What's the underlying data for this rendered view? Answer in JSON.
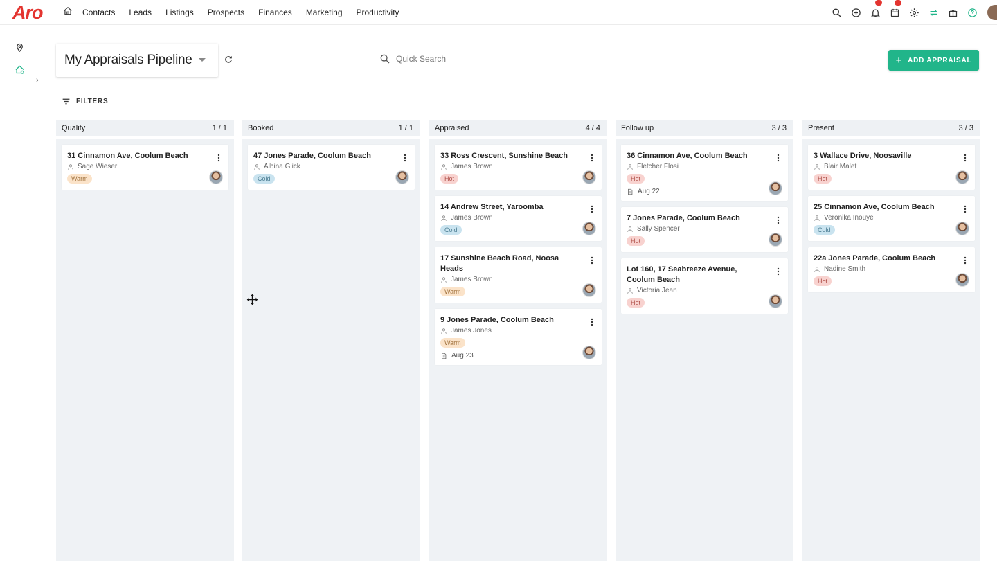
{
  "app": {
    "logo": "Aro"
  },
  "nav": [
    "Contacts",
    "Leads",
    "Listings",
    "Prospects",
    "Finances",
    "Marketing",
    "Productivity"
  ],
  "header": {
    "pipeline_title": "My Appraisals Pipeline",
    "search_placeholder": "Quick Search",
    "add_button": "ADD APPRAISAL",
    "filters_label": "FILTERS"
  },
  "colors": {
    "accent": "#21b58a",
    "brand": "#e3342f"
  },
  "columns": [
    {
      "name": "Qualify",
      "count": "1 / 1",
      "cards": [
        {
          "title": "31 Cinnamon Ave, Coolum Beach",
          "person": "Sage Wieser",
          "tag": "Warm"
        }
      ]
    },
    {
      "name": "Booked",
      "count": "1 / 1",
      "cards": [
        {
          "title": "47 Jones Parade, Coolum Beach",
          "person": "Albina Glick",
          "tag": "Cold"
        }
      ]
    },
    {
      "name": "Appraised",
      "count": "4 / 4",
      "cards": [
        {
          "title": "33 Ross Crescent, Sunshine Beach",
          "person": "James Brown",
          "tag": "Hot"
        },
        {
          "title": "14 Andrew Street, Yaroomba",
          "person": "James Brown",
          "tag": "Cold"
        },
        {
          "title": "17 Sunshine Beach Road, Noosa Heads",
          "person": "James Brown",
          "tag": "Warm"
        },
        {
          "title": "9 Jones Parade, Coolum Beach",
          "person": "James Jones",
          "tag": "Warm",
          "date": "Aug 23"
        }
      ]
    },
    {
      "name": "Follow up",
      "count": "3 / 3",
      "cards": [
        {
          "title": "36 Cinnamon Ave, Coolum Beach",
          "person": "Fletcher Flosi",
          "tag": "Hot",
          "date": "Aug 22"
        },
        {
          "title": "7 Jones Parade, Coolum Beach",
          "person": "Sally Spencer",
          "tag": "Hot"
        },
        {
          "title": "Lot 160, 17 Seabreeze Avenue, Coolum Beach",
          "person": "Victoria Jean",
          "tag": "Hot"
        }
      ]
    },
    {
      "name": "Present",
      "count": "3 / 3",
      "cards": [
        {
          "title": "3 Wallace Drive, Noosaville",
          "person": "Blair Malet",
          "tag": "Hot"
        },
        {
          "title": "25 Cinnamon Ave, Coolum Beach",
          "person": "Veronika Inouye",
          "tag": "Cold"
        },
        {
          "title": "22a Jones Parade, Coolum Beach",
          "person": "Nadine Smith",
          "tag": "Hot"
        }
      ]
    }
  ]
}
